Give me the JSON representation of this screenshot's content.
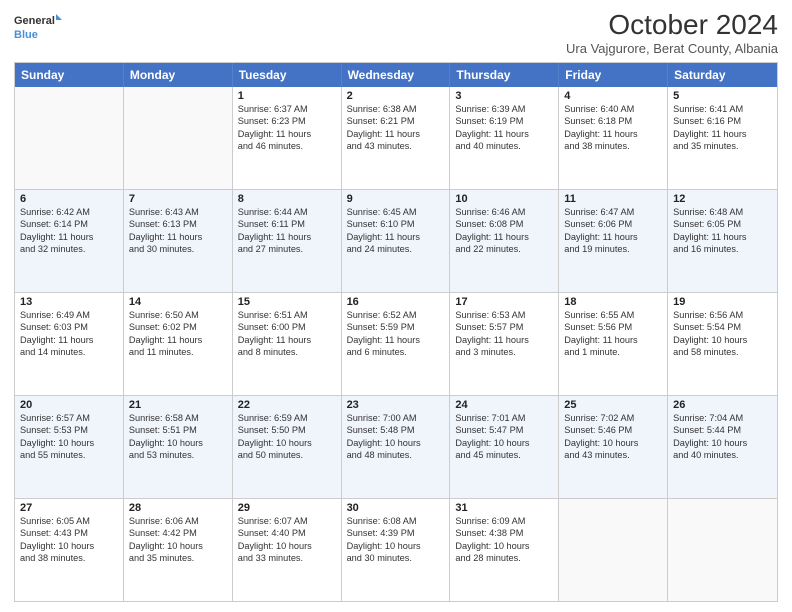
{
  "header": {
    "logo_line1": "General",
    "logo_line2": "Blue",
    "title": "October 2024",
    "subtitle": "Ura Vajgurore, Berat County, Albania"
  },
  "calendar": {
    "days": [
      "Sunday",
      "Monday",
      "Tuesday",
      "Wednesday",
      "Thursday",
      "Friday",
      "Saturday"
    ],
    "rows": [
      [
        {
          "day": "",
          "empty": true
        },
        {
          "day": "",
          "empty": true
        },
        {
          "day": "1",
          "line1": "Sunrise: 6:37 AM",
          "line2": "Sunset: 6:23 PM",
          "line3": "Daylight: 11 hours",
          "line4": "and 46 minutes."
        },
        {
          "day": "2",
          "line1": "Sunrise: 6:38 AM",
          "line2": "Sunset: 6:21 PM",
          "line3": "Daylight: 11 hours",
          "line4": "and 43 minutes."
        },
        {
          "day": "3",
          "line1": "Sunrise: 6:39 AM",
          "line2": "Sunset: 6:19 PM",
          "line3": "Daylight: 11 hours",
          "line4": "and 40 minutes."
        },
        {
          "day": "4",
          "line1": "Sunrise: 6:40 AM",
          "line2": "Sunset: 6:18 PM",
          "line3": "Daylight: 11 hours",
          "line4": "and 38 minutes."
        },
        {
          "day": "5",
          "line1": "Sunrise: 6:41 AM",
          "line2": "Sunset: 6:16 PM",
          "line3": "Daylight: 11 hours",
          "line4": "and 35 minutes."
        }
      ],
      [
        {
          "day": "6",
          "line1": "Sunrise: 6:42 AM",
          "line2": "Sunset: 6:14 PM",
          "line3": "Daylight: 11 hours",
          "line4": "and 32 minutes."
        },
        {
          "day": "7",
          "line1": "Sunrise: 6:43 AM",
          "line2": "Sunset: 6:13 PM",
          "line3": "Daylight: 11 hours",
          "line4": "and 30 minutes."
        },
        {
          "day": "8",
          "line1": "Sunrise: 6:44 AM",
          "line2": "Sunset: 6:11 PM",
          "line3": "Daylight: 11 hours",
          "line4": "and 27 minutes."
        },
        {
          "day": "9",
          "line1": "Sunrise: 6:45 AM",
          "line2": "Sunset: 6:10 PM",
          "line3": "Daylight: 11 hours",
          "line4": "and 24 minutes."
        },
        {
          "day": "10",
          "line1": "Sunrise: 6:46 AM",
          "line2": "Sunset: 6:08 PM",
          "line3": "Daylight: 11 hours",
          "line4": "and 22 minutes."
        },
        {
          "day": "11",
          "line1": "Sunrise: 6:47 AM",
          "line2": "Sunset: 6:06 PM",
          "line3": "Daylight: 11 hours",
          "line4": "and 19 minutes."
        },
        {
          "day": "12",
          "line1": "Sunrise: 6:48 AM",
          "line2": "Sunset: 6:05 PM",
          "line3": "Daylight: 11 hours",
          "line4": "and 16 minutes."
        }
      ],
      [
        {
          "day": "13",
          "line1": "Sunrise: 6:49 AM",
          "line2": "Sunset: 6:03 PM",
          "line3": "Daylight: 11 hours",
          "line4": "and 14 minutes."
        },
        {
          "day": "14",
          "line1": "Sunrise: 6:50 AM",
          "line2": "Sunset: 6:02 PM",
          "line3": "Daylight: 11 hours",
          "line4": "and 11 minutes."
        },
        {
          "day": "15",
          "line1": "Sunrise: 6:51 AM",
          "line2": "Sunset: 6:00 PM",
          "line3": "Daylight: 11 hours",
          "line4": "and 8 minutes."
        },
        {
          "day": "16",
          "line1": "Sunrise: 6:52 AM",
          "line2": "Sunset: 5:59 PM",
          "line3": "Daylight: 11 hours",
          "line4": "and 6 minutes."
        },
        {
          "day": "17",
          "line1": "Sunrise: 6:53 AM",
          "line2": "Sunset: 5:57 PM",
          "line3": "Daylight: 11 hours",
          "line4": "and 3 minutes."
        },
        {
          "day": "18",
          "line1": "Sunrise: 6:55 AM",
          "line2": "Sunset: 5:56 PM",
          "line3": "Daylight: 11 hours",
          "line4": "and 1 minute."
        },
        {
          "day": "19",
          "line1": "Sunrise: 6:56 AM",
          "line2": "Sunset: 5:54 PM",
          "line3": "Daylight: 10 hours",
          "line4": "and 58 minutes."
        }
      ],
      [
        {
          "day": "20",
          "line1": "Sunrise: 6:57 AM",
          "line2": "Sunset: 5:53 PM",
          "line3": "Daylight: 10 hours",
          "line4": "and 55 minutes."
        },
        {
          "day": "21",
          "line1": "Sunrise: 6:58 AM",
          "line2": "Sunset: 5:51 PM",
          "line3": "Daylight: 10 hours",
          "line4": "and 53 minutes."
        },
        {
          "day": "22",
          "line1": "Sunrise: 6:59 AM",
          "line2": "Sunset: 5:50 PM",
          "line3": "Daylight: 10 hours",
          "line4": "and 50 minutes."
        },
        {
          "day": "23",
          "line1": "Sunrise: 7:00 AM",
          "line2": "Sunset: 5:48 PM",
          "line3": "Daylight: 10 hours",
          "line4": "and 48 minutes."
        },
        {
          "day": "24",
          "line1": "Sunrise: 7:01 AM",
          "line2": "Sunset: 5:47 PM",
          "line3": "Daylight: 10 hours",
          "line4": "and 45 minutes."
        },
        {
          "day": "25",
          "line1": "Sunrise: 7:02 AM",
          "line2": "Sunset: 5:46 PM",
          "line3": "Daylight: 10 hours",
          "line4": "and 43 minutes."
        },
        {
          "day": "26",
          "line1": "Sunrise: 7:04 AM",
          "line2": "Sunset: 5:44 PM",
          "line3": "Daylight: 10 hours",
          "line4": "and 40 minutes."
        }
      ],
      [
        {
          "day": "27",
          "line1": "Sunrise: 6:05 AM",
          "line2": "Sunset: 4:43 PM",
          "line3": "Daylight: 10 hours",
          "line4": "and 38 minutes."
        },
        {
          "day": "28",
          "line1": "Sunrise: 6:06 AM",
          "line2": "Sunset: 4:42 PM",
          "line3": "Daylight: 10 hours",
          "line4": "and 35 minutes."
        },
        {
          "day": "29",
          "line1": "Sunrise: 6:07 AM",
          "line2": "Sunset: 4:40 PM",
          "line3": "Daylight: 10 hours",
          "line4": "and 33 minutes."
        },
        {
          "day": "30",
          "line1": "Sunrise: 6:08 AM",
          "line2": "Sunset: 4:39 PM",
          "line3": "Daylight: 10 hours",
          "line4": "and 30 minutes."
        },
        {
          "day": "31",
          "line1": "Sunrise: 6:09 AM",
          "line2": "Sunset: 4:38 PM",
          "line3": "Daylight: 10 hours",
          "line4": "and 28 minutes."
        },
        {
          "day": "",
          "empty": true
        },
        {
          "day": "",
          "empty": true
        }
      ]
    ]
  }
}
